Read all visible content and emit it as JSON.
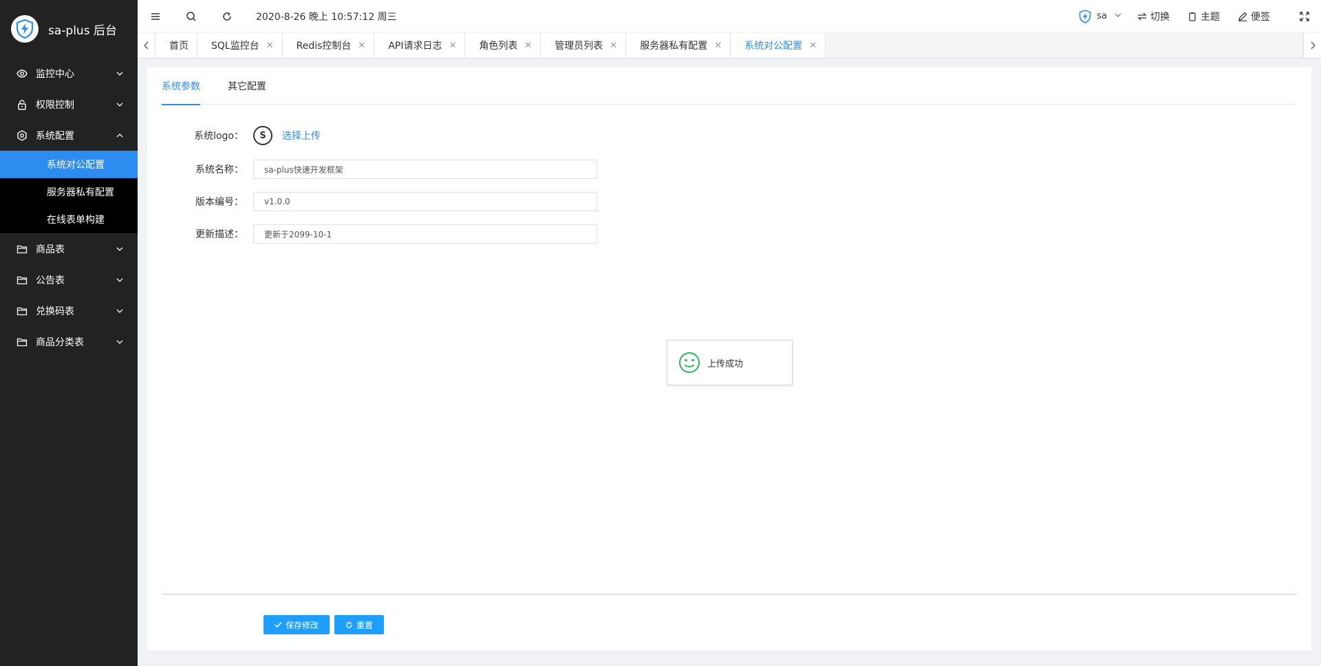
{
  "app": {
    "title": "sa-plus 后台"
  },
  "sidebar": {
    "items": [
      {
        "label": "监控中心",
        "icon": "eye-icon"
      },
      {
        "label": "权限控制",
        "icon": "lock-icon"
      },
      {
        "label": "系统配置",
        "icon": "gear-icon",
        "children": [
          "系统对公配置",
          "服务器私有配置",
          "在线表单构建"
        ]
      },
      {
        "label": "商品表",
        "icon": "folder-icon"
      },
      {
        "label": "公告表",
        "icon": "folder-icon"
      },
      {
        "label": "兑换码表",
        "icon": "folder-icon"
      },
      {
        "label": "商品分类表",
        "icon": "folder-icon"
      }
    ],
    "active_child": "系统对公配置"
  },
  "topbar": {
    "datetime": "2020-8-26 晚上 10:57:12 周三",
    "user": "sa",
    "switch_label": "切换",
    "theme_label": "主题",
    "note_label": "便签"
  },
  "tabs": [
    "首页",
    "SQL监控台",
    "Redis控制台",
    "API请求日志",
    "角色列表",
    "管理员列表",
    "服务器私有配置",
    "系统对公配置"
  ],
  "active_tab": "系统对公配置",
  "content_tabs": [
    "系统参数",
    "其它配置"
  ],
  "form": {
    "logo_label": "系统logo：",
    "logo_letter": "S",
    "upload_label": "选择上传",
    "name_label": "系统名称：",
    "name_value": "sa-plus快速开发框架",
    "version_label": "版本编号：",
    "version_value": "v1.0.0",
    "desc_label": "更新描述：",
    "desc_value": "更新于2099-10-1"
  },
  "toast": {
    "text": "上传成功",
    "icon": "smile-icon"
  },
  "buttons": {
    "save": "保存修改",
    "reset": "重置"
  },
  "colors": {
    "sidebar_bg": "#222222",
    "accent": "#2d8cf0",
    "button": "#1e9fff",
    "success": "#2db55d"
  }
}
